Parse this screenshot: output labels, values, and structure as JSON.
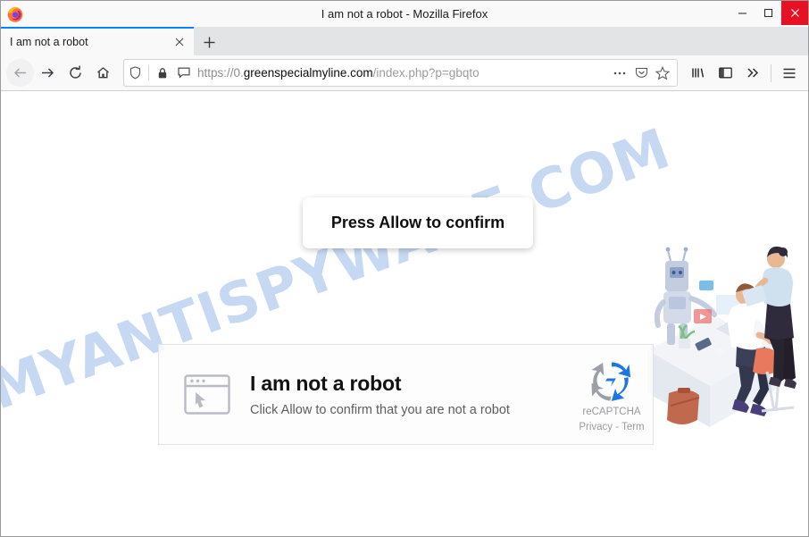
{
  "window": {
    "title": "I am not a robot - Mozilla Firefox",
    "logo_icon": "firefox-logo",
    "minimize_label": "—",
    "maximize_label": "□",
    "close_label": "✕"
  },
  "tabs": {
    "active": {
      "label": "I am not a robot",
      "close_label": "✕"
    },
    "new_tab_label": "+"
  },
  "toolbar": {
    "back_icon": "back-arrow-icon",
    "forward_icon": "forward-arrow-icon",
    "reload_icon": "reload-icon",
    "home_icon": "home-icon",
    "library_icon": "library-icon",
    "sidebar_icon": "sidebar-icon",
    "overflow_icon": "double-chevron-icon",
    "menu_icon": "hamburger-menu-icon"
  },
  "urlbar": {
    "scheme": "https://0.",
    "domain": "greenspecialmyline.com",
    "path": "/index.php?p=gbqto",
    "full_url": "https://0.greenspecialmyline.com/index.php?p=gbqto",
    "shield_icon": "tracking-protection-shield-icon",
    "lock_icon": "padlock-icon",
    "permission_icon": "site-permission-icon",
    "ellipsis_icon": "page-actions-ellipsis-icon",
    "pocket_icon": "pocket-icon",
    "bookmark_icon": "star-bookmark-icon"
  },
  "page": {
    "watermark": "MYANTISPYWARE.COM",
    "allow_prompt": "Press Allow to confirm",
    "captcha": {
      "window_icon": "browser-window-cursor-icon",
      "title": "I am not a robot",
      "subtitle": "Click Allow to confirm that you are not a robot",
      "recaptcha_logo_icon": "recaptcha-logo-icon",
      "recaptcha_name": "reCAPTCHA",
      "recaptcha_links": "Privacy - Term"
    },
    "illustration": "office-robot-workers-illustration"
  },
  "colors": {
    "accent_tab": "#0a84ff",
    "close_button": "#e81123",
    "watermark": "#c3d6f2",
    "recaptcha_blue": "#1c77e3",
    "recaptcha_gray": "#9aa0a6"
  }
}
